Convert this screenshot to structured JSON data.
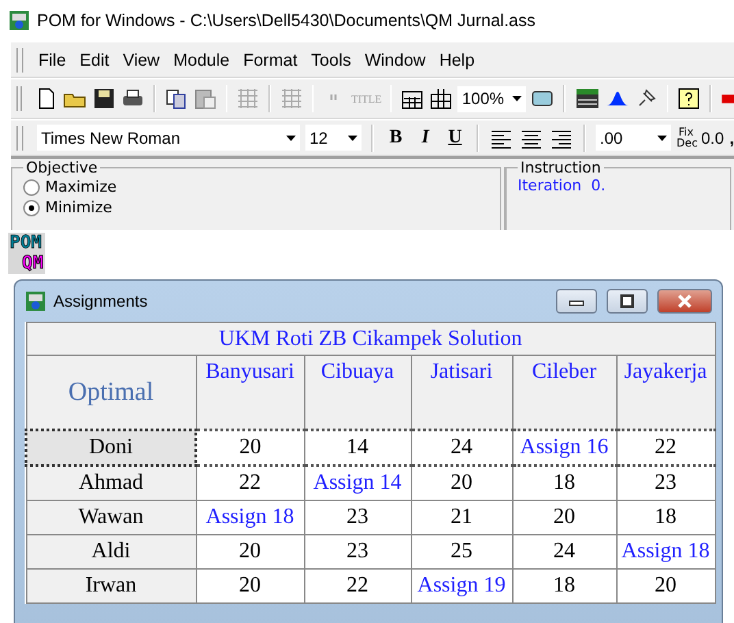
{
  "window": {
    "title": "POM for Windows - C:\\Users\\Dell5430\\Documents\\QM Jurnal.ass"
  },
  "menu": [
    "File",
    "Edit",
    "View",
    "Module",
    "Format",
    "Tools",
    "Window",
    "Help"
  ],
  "toolbar": {
    "title_label": "TITLE",
    "zoom": "100%"
  },
  "format_bar": {
    "font": "Times New Roman",
    "size": "12",
    "bold": "B",
    "italic": "I",
    "underline": "U",
    "decimals": ".00",
    "fix_dec": "Fix Dec",
    "decimal_format": "0.0",
    "comma": ","
  },
  "objective": {
    "label": "Objective",
    "options": [
      {
        "label": "Maximize",
        "selected": false
      },
      {
        "label": "Minimize",
        "selected": true
      }
    ]
  },
  "instruction": {
    "label": "Instruction",
    "text": "Iteration  0."
  },
  "logo": {
    "top": "POM",
    "bottom": "QM"
  },
  "assignments": {
    "title": "Assignments",
    "table_title": "UKM Roti ZB Cikampek Solution",
    "corner": "Optimal",
    "columns": [
      "Banyusari",
      "Cibuaya",
      "Jatisari",
      "Cileber",
      "Jayakerja"
    ],
    "rows": [
      {
        "name": "Doni",
        "selected": true,
        "cells": [
          {
            "text": "20",
            "assigned": false
          },
          {
            "text": "14",
            "assigned": false
          },
          {
            "text": "24",
            "assigned": false
          },
          {
            "text": "Assign 16",
            "assigned": true
          },
          {
            "text": "22",
            "assigned": false
          }
        ]
      },
      {
        "name": "Ahmad",
        "selected": false,
        "cells": [
          {
            "text": "22",
            "assigned": false
          },
          {
            "text": "Assign 14",
            "assigned": true
          },
          {
            "text": "20",
            "assigned": false
          },
          {
            "text": "18",
            "assigned": false
          },
          {
            "text": "23",
            "assigned": false
          }
        ]
      },
      {
        "name": "Wawan",
        "selected": false,
        "cells": [
          {
            "text": "Assign 18",
            "assigned": true
          },
          {
            "text": "23",
            "assigned": false
          },
          {
            "text": "21",
            "assigned": false
          },
          {
            "text": "20",
            "assigned": false
          },
          {
            "text": "18",
            "assigned": false
          }
        ]
      },
      {
        "name": "Aldi",
        "selected": false,
        "cells": [
          {
            "text": "20",
            "assigned": false
          },
          {
            "text": "23",
            "assigned": false
          },
          {
            "text": "25",
            "assigned": false
          },
          {
            "text": "24",
            "assigned": false
          },
          {
            "text": "Assign 18",
            "assigned": true
          }
        ]
      },
      {
        "name": "Irwan",
        "selected": false,
        "cells": [
          {
            "text": "20",
            "assigned": false
          },
          {
            "text": "22",
            "assigned": false
          },
          {
            "text": "Assign 19",
            "assigned": true
          },
          {
            "text": "18",
            "assigned": false
          },
          {
            "text": "20",
            "assigned": false
          }
        ]
      }
    ]
  }
}
